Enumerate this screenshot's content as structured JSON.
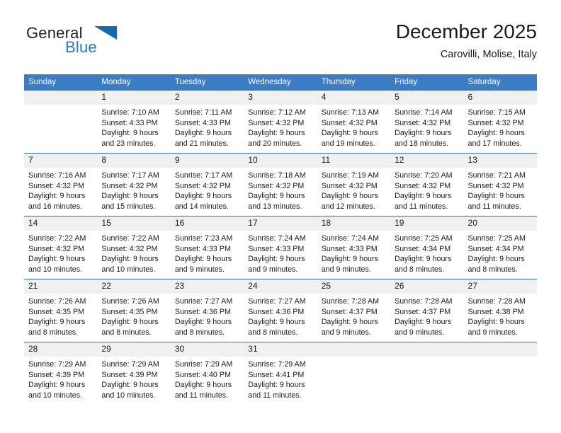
{
  "logo": {
    "word_one": "General",
    "word_two": "Blue",
    "icon": "triangle-logo-icon",
    "color_primary": "#231f20",
    "color_accent": "#1b7ac4"
  },
  "header": {
    "title": "December 2025",
    "subtitle": "Carovilli, Molise, Italy"
  },
  "theme": {
    "header_bg": "#3b7dc4",
    "row_divider": "#2f6fb5",
    "daynum_bg": "#f0f0f0"
  },
  "calendar": {
    "weekdays": [
      "Sunday",
      "Monday",
      "Tuesday",
      "Wednesday",
      "Thursday",
      "Friday",
      "Saturday"
    ],
    "weeks": [
      [
        {
          "day": "",
          "blank": true,
          "sunrise": "",
          "sunset": "",
          "daylight_1": "",
          "daylight_2": ""
        },
        {
          "day": "1",
          "blank": false,
          "sunrise": "Sunrise: 7:10 AM",
          "sunset": "Sunset: 4:33 PM",
          "daylight_1": "Daylight: 9 hours",
          "daylight_2": "and 23 minutes."
        },
        {
          "day": "2",
          "blank": false,
          "sunrise": "Sunrise: 7:11 AM",
          "sunset": "Sunset: 4:33 PM",
          "daylight_1": "Daylight: 9 hours",
          "daylight_2": "and 21 minutes."
        },
        {
          "day": "3",
          "blank": false,
          "sunrise": "Sunrise: 7:12 AM",
          "sunset": "Sunset: 4:32 PM",
          "daylight_1": "Daylight: 9 hours",
          "daylight_2": "and 20 minutes."
        },
        {
          "day": "4",
          "blank": false,
          "sunrise": "Sunrise: 7:13 AM",
          "sunset": "Sunset: 4:32 PM",
          "daylight_1": "Daylight: 9 hours",
          "daylight_2": "and 19 minutes."
        },
        {
          "day": "5",
          "blank": false,
          "sunrise": "Sunrise: 7:14 AM",
          "sunset": "Sunset: 4:32 PM",
          "daylight_1": "Daylight: 9 hours",
          "daylight_2": "and 18 minutes."
        },
        {
          "day": "6",
          "blank": false,
          "sunrise": "Sunrise: 7:15 AM",
          "sunset": "Sunset: 4:32 PM",
          "daylight_1": "Daylight: 9 hours",
          "daylight_2": "and 17 minutes."
        }
      ],
      [
        {
          "day": "7",
          "blank": false,
          "sunrise": "Sunrise: 7:16 AM",
          "sunset": "Sunset: 4:32 PM",
          "daylight_1": "Daylight: 9 hours",
          "daylight_2": "and 16 minutes."
        },
        {
          "day": "8",
          "blank": false,
          "sunrise": "Sunrise: 7:17 AM",
          "sunset": "Sunset: 4:32 PM",
          "daylight_1": "Daylight: 9 hours",
          "daylight_2": "and 15 minutes."
        },
        {
          "day": "9",
          "blank": false,
          "sunrise": "Sunrise: 7:17 AM",
          "sunset": "Sunset: 4:32 PM",
          "daylight_1": "Daylight: 9 hours",
          "daylight_2": "and 14 minutes."
        },
        {
          "day": "10",
          "blank": false,
          "sunrise": "Sunrise: 7:18 AM",
          "sunset": "Sunset: 4:32 PM",
          "daylight_1": "Daylight: 9 hours",
          "daylight_2": "and 13 minutes."
        },
        {
          "day": "11",
          "blank": false,
          "sunrise": "Sunrise: 7:19 AM",
          "sunset": "Sunset: 4:32 PM",
          "daylight_1": "Daylight: 9 hours",
          "daylight_2": "and 12 minutes."
        },
        {
          "day": "12",
          "blank": false,
          "sunrise": "Sunrise: 7:20 AM",
          "sunset": "Sunset: 4:32 PM",
          "daylight_1": "Daylight: 9 hours",
          "daylight_2": "and 11 minutes."
        },
        {
          "day": "13",
          "blank": false,
          "sunrise": "Sunrise: 7:21 AM",
          "sunset": "Sunset: 4:32 PM",
          "daylight_1": "Daylight: 9 hours",
          "daylight_2": "and 11 minutes."
        }
      ],
      [
        {
          "day": "14",
          "blank": false,
          "sunrise": "Sunrise: 7:22 AM",
          "sunset": "Sunset: 4:32 PM",
          "daylight_1": "Daylight: 9 hours",
          "daylight_2": "and 10 minutes."
        },
        {
          "day": "15",
          "blank": false,
          "sunrise": "Sunrise: 7:22 AM",
          "sunset": "Sunset: 4:32 PM",
          "daylight_1": "Daylight: 9 hours",
          "daylight_2": "and 10 minutes."
        },
        {
          "day": "16",
          "blank": false,
          "sunrise": "Sunrise: 7:23 AM",
          "sunset": "Sunset: 4:33 PM",
          "daylight_1": "Daylight: 9 hours",
          "daylight_2": "and 9 minutes."
        },
        {
          "day": "17",
          "blank": false,
          "sunrise": "Sunrise: 7:24 AM",
          "sunset": "Sunset: 4:33 PM",
          "daylight_1": "Daylight: 9 hours",
          "daylight_2": "and 9 minutes."
        },
        {
          "day": "18",
          "blank": false,
          "sunrise": "Sunrise: 7:24 AM",
          "sunset": "Sunset: 4:33 PM",
          "daylight_1": "Daylight: 9 hours",
          "daylight_2": "and 9 minutes."
        },
        {
          "day": "19",
          "blank": false,
          "sunrise": "Sunrise: 7:25 AM",
          "sunset": "Sunset: 4:34 PM",
          "daylight_1": "Daylight: 9 hours",
          "daylight_2": "and 8 minutes."
        },
        {
          "day": "20",
          "blank": false,
          "sunrise": "Sunrise: 7:25 AM",
          "sunset": "Sunset: 4:34 PM",
          "daylight_1": "Daylight: 9 hours",
          "daylight_2": "and 8 minutes."
        }
      ],
      [
        {
          "day": "21",
          "blank": false,
          "sunrise": "Sunrise: 7:26 AM",
          "sunset": "Sunset: 4:35 PM",
          "daylight_1": "Daylight: 9 hours",
          "daylight_2": "and 8 minutes."
        },
        {
          "day": "22",
          "blank": false,
          "sunrise": "Sunrise: 7:26 AM",
          "sunset": "Sunset: 4:35 PM",
          "daylight_1": "Daylight: 9 hours",
          "daylight_2": "and 8 minutes."
        },
        {
          "day": "23",
          "blank": false,
          "sunrise": "Sunrise: 7:27 AM",
          "sunset": "Sunset: 4:36 PM",
          "daylight_1": "Daylight: 9 hours",
          "daylight_2": "and 8 minutes."
        },
        {
          "day": "24",
          "blank": false,
          "sunrise": "Sunrise: 7:27 AM",
          "sunset": "Sunset: 4:36 PM",
          "daylight_1": "Daylight: 9 hours",
          "daylight_2": "and 8 minutes."
        },
        {
          "day": "25",
          "blank": false,
          "sunrise": "Sunrise: 7:28 AM",
          "sunset": "Sunset: 4:37 PM",
          "daylight_1": "Daylight: 9 hours",
          "daylight_2": "and 9 minutes."
        },
        {
          "day": "26",
          "blank": false,
          "sunrise": "Sunrise: 7:28 AM",
          "sunset": "Sunset: 4:37 PM",
          "daylight_1": "Daylight: 9 hours",
          "daylight_2": "and 9 minutes."
        },
        {
          "day": "27",
          "blank": false,
          "sunrise": "Sunrise: 7:28 AM",
          "sunset": "Sunset: 4:38 PM",
          "daylight_1": "Daylight: 9 hours",
          "daylight_2": "and 9 minutes."
        }
      ],
      [
        {
          "day": "28",
          "blank": false,
          "sunrise": "Sunrise: 7:29 AM",
          "sunset": "Sunset: 4:39 PM",
          "daylight_1": "Daylight: 9 hours",
          "daylight_2": "and 10 minutes."
        },
        {
          "day": "29",
          "blank": false,
          "sunrise": "Sunrise: 7:29 AM",
          "sunset": "Sunset: 4:39 PM",
          "daylight_1": "Daylight: 9 hours",
          "daylight_2": "and 10 minutes."
        },
        {
          "day": "30",
          "blank": false,
          "sunrise": "Sunrise: 7:29 AM",
          "sunset": "Sunset: 4:40 PM",
          "daylight_1": "Daylight: 9 hours",
          "daylight_2": "and 11 minutes."
        },
        {
          "day": "31",
          "blank": false,
          "sunrise": "Sunrise: 7:29 AM",
          "sunset": "Sunset: 4:41 PM",
          "daylight_1": "Daylight: 9 hours",
          "daylight_2": "and 11 minutes."
        },
        {
          "day": "",
          "blank": true,
          "sunrise": "",
          "sunset": "",
          "daylight_1": "",
          "daylight_2": ""
        },
        {
          "day": "",
          "blank": true,
          "sunrise": "",
          "sunset": "",
          "daylight_1": "",
          "daylight_2": ""
        },
        {
          "day": "",
          "blank": true,
          "sunrise": "",
          "sunset": "",
          "daylight_1": "",
          "daylight_2": ""
        }
      ]
    ]
  }
}
